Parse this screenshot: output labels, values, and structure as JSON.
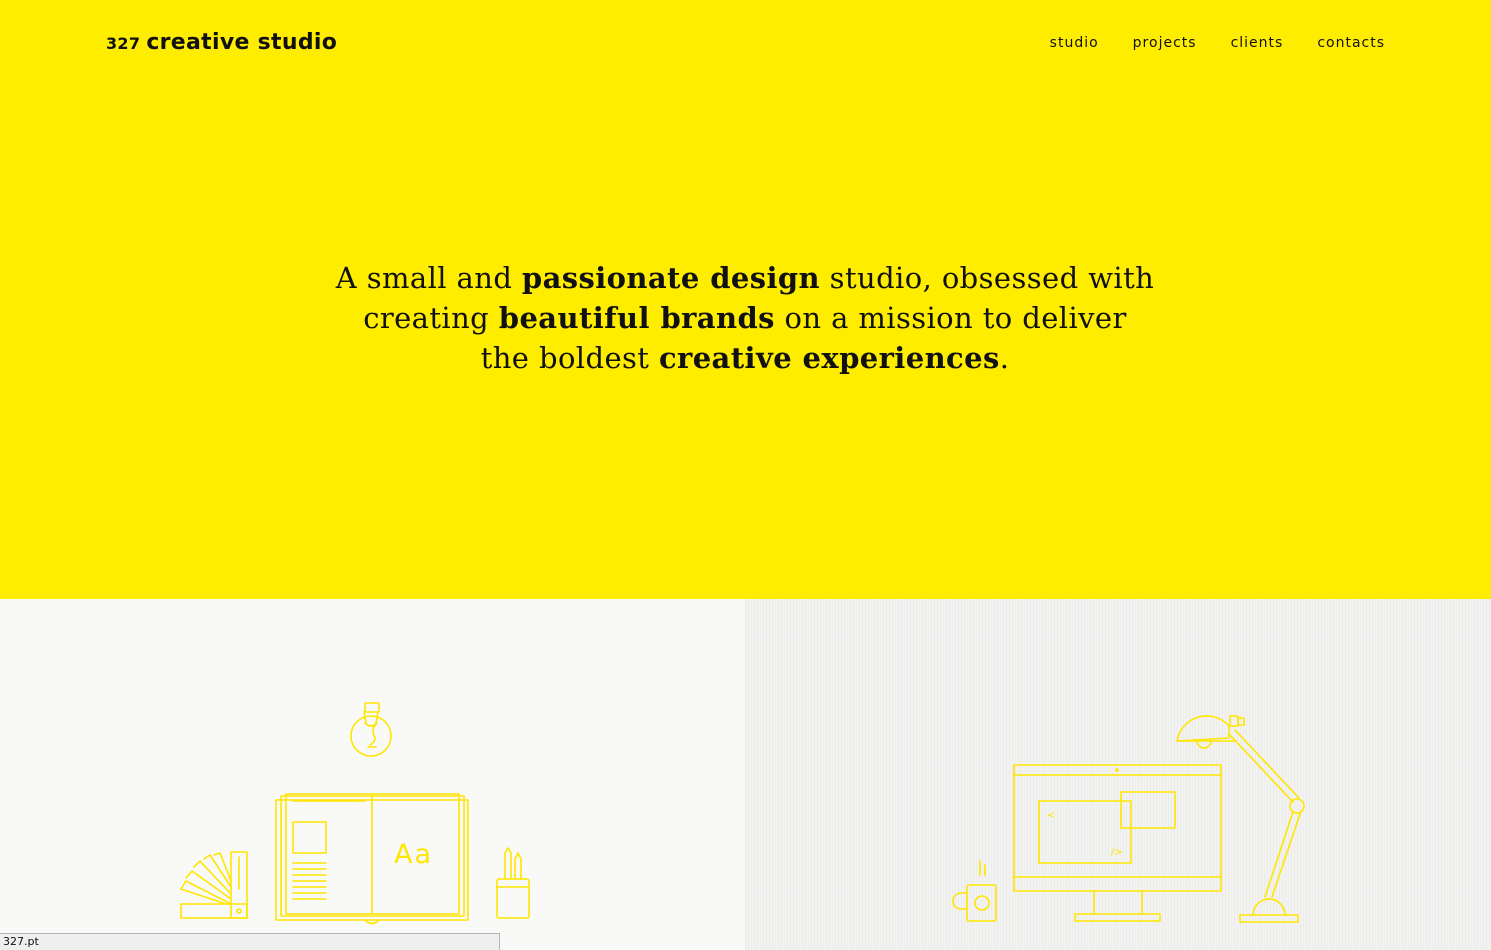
{
  "header": {
    "logo_number": "327",
    "logo_text": "creative studio",
    "nav": [
      {
        "label": "studio"
      },
      {
        "label": "projects"
      },
      {
        "label": "clients"
      },
      {
        "label": "contacts"
      }
    ]
  },
  "hero": {
    "background": "#ffed00",
    "line1": {
      "a": "A small and ",
      "b": "passionate design",
      "c": " studio, obsessed with"
    },
    "line2": {
      "a": "creating ",
      "b": "beautiful brands",
      "c": " on a mission to deliver"
    },
    "line3": {
      "a": "the boldest ",
      "b": "creative experiences",
      "c": "."
    }
  },
  "illustrations": {
    "accent": "#ffe600",
    "left_book_text": "Aa",
    "left_icons": [
      "lightbulb-icon",
      "color-swatch-fan-icon",
      "open-book-icon",
      "pencil-cup-icon"
    ],
    "right_code_glyph_left": "<",
    "right_code_glyph_right": "/>",
    "right_icons": [
      "coffee-mug-icon",
      "desktop-monitor-icon",
      "desk-lamp-icon"
    ]
  },
  "statusbar": {
    "url": "327.pt"
  }
}
